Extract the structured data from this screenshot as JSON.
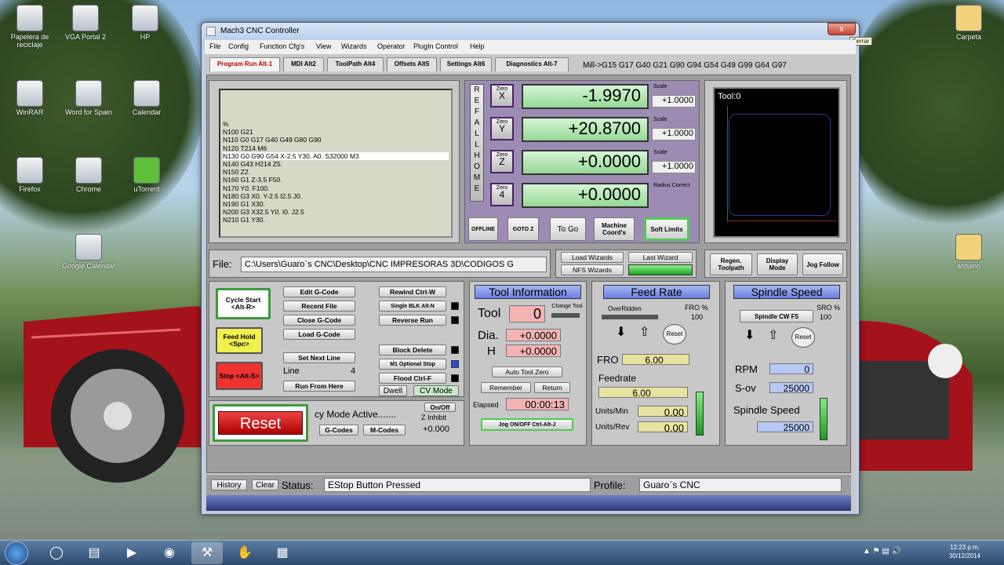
{
  "window": {
    "title": "Mach3 CNC Controller",
    "close_glyph": "x",
    "close_tooltip": "Cerrar"
  },
  "menu": [
    "File",
    "Config",
    "Function Cfg's",
    "View",
    "Wizards",
    "Operator",
    "PlugIn Control",
    "Help"
  ],
  "tabs": [
    "Program Run Alt-1",
    "MDI Alt2",
    "ToolPath Alt4",
    "Offsets Alt5",
    "Settings Alt6",
    "Diagnostics Alt-7"
  ],
  "active_gcodes": "Mill->G15  G17 G40 G21 G90 G94 G54 G49 G99 G64 G97",
  "gcode_lines": [
    "%",
    "N100 G21",
    "N110 G0 G17 G40 G49 G80 G90",
    "N120 T214 M6",
    "N130 G0 G90 G54 X-2.5 Y30. A0. S32000 M3",
    "N140 G43 H214 Z5.",
    "N150 Z2.",
    "N160 G1 Z-3.5 F50.",
    "N170 Y0. F100.",
    "N180 G3 X0. Y-2.5 I2.5 J0.",
    "N190 G1 X30.",
    "N200 G3 X32.5 Y0. I0. J2.5",
    "N210 G1 Y30."
  ],
  "gcode_highlight_index": 4,
  "ref_all_home": [
    "R",
    "E",
    "F",
    "A",
    "L",
    "L",
    "H",
    "O",
    "M",
    "E"
  ],
  "axes": [
    {
      "zero_label": "Zero",
      "axis": "X",
      "value": "-1.9970",
      "scale_label": "Scale",
      "scale": "+1.0000"
    },
    {
      "zero_label": "Zero",
      "axis": "Y",
      "value": "+20.8700",
      "scale_label": "Scale",
      "scale": "+1.0000"
    },
    {
      "zero_label": "Zero",
      "axis": "Z",
      "value": "+0.0000",
      "scale_label": "Scale",
      "scale": "+1.0000"
    },
    {
      "zero_label": "Zero",
      "axis": "4",
      "value": "+0.0000",
      "scale_label": "Radius Correct",
      "scale": ""
    }
  ],
  "dro_buttons": [
    "OFFLINE",
    "GOTO Z",
    "To Go",
    "Machine Coord's",
    "Soft Limits"
  ],
  "toolpath": {
    "label": "Tool:0"
  },
  "file": {
    "label": "File:",
    "path": "C:\\Users\\Guaro`s CNC\\Desktop\\CNC IMPRESORAS 3D\\CODIGOS G"
  },
  "wizards": {
    "load": "Load Wizards",
    "last": "Last Wizard",
    "nfs": "NFS Wizards"
  },
  "view_buttons": [
    "Regen. Toolpath",
    "Display Mode",
    "Jog Follow"
  ],
  "program_buttons": {
    "cycle_start": "Cycle Start <Alt-R>",
    "feed_hold": "Feed Hold <Spc>",
    "stop": "Stop <Alt-S>",
    "edit": "Edit G-Code",
    "recent": "Recent File",
    "close": "Close G-Code",
    "load": "Load G-Code",
    "set_next": "Set Next Line",
    "line_label": "Line",
    "line_value": "4",
    "run_from_here": "Run From Here",
    "rewind": "Rewind Ctrl-W",
    "single_blk": "Single BLK Alt-N",
    "reverse_run": "Reverse Run",
    "block_delete": "Block Delete",
    "m1_optional": "M1 Optional Stop",
    "flood": "Flood Ctrl-F",
    "dwell": "Dwell",
    "cv_mode": "CV Mode"
  },
  "reset": {
    "label": "Reset",
    "cy_mode": "cy Mode Active.......",
    "on_off": "On/Off",
    "z_inhibit": "Z Inhibit",
    "z_value": "+0.000",
    "gcodes_btn": "G-Codes",
    "mcodes_btn": "M-Codes"
  },
  "tool_info": {
    "header": "Tool Information",
    "tool_label": "Tool",
    "tool_value": "0",
    "change": "Change Tool",
    "dia_label": "Dia.",
    "dia_value": "+0.0000",
    "h_label": "H",
    "h_value": "+0.0000",
    "auto_zero": "Auto Tool Zero",
    "remember": "Remember",
    "return": "Return",
    "elapsed_label": "Elapsed",
    "elapsed_value": "00:00:13",
    "jog": "Jog ON/OFF Ctrl-Alt-J"
  },
  "feed": {
    "header": "Feed Rate",
    "overridden": "OverRidden",
    "fro_pct_label": "FRO %",
    "fro_pct": "100",
    "reset": "Reset",
    "fro_label": "FRO",
    "fro_value": "6.00",
    "feedrate_label": "Feedrate",
    "feedrate_value": "6.00",
    "units_min_label": "Units/Min",
    "units_min": "0.00",
    "units_rev_label": "Units/Rev",
    "units_rev": "0.00"
  },
  "spindle": {
    "header": "Spindle Speed",
    "cw": "Spindle CW F5",
    "sro_label": "SRO %",
    "sro": "100",
    "reset": "Reset",
    "rpm_label": "RPM",
    "rpm": "0",
    "sov_label": "S-ov",
    "sov": "25000",
    "speed_label": "Spindle Speed",
    "speed": "25000"
  },
  "status": {
    "history": "History",
    "clear": "Clear",
    "label": "Status:",
    "text": "EStop Button Pressed",
    "profile_label": "Profile:",
    "profile": "Guaro`s CNC"
  },
  "desktop_icons": [
    {
      "label": "Papelera de reciclaje"
    },
    {
      "label": "VGA Portal 2"
    },
    {
      "label": "HP"
    },
    {
      "label": "WinRAR"
    },
    {
      "label": "Word for Spain"
    },
    {
      "label": "Calendar"
    },
    {
      "label": "Firefox"
    },
    {
      "label": "Chrome"
    },
    {
      "label": "uTorrent"
    },
    {
      "label": "Carpeta"
    },
    {
      "label": "Google Calendar"
    },
    {
      "label": "arduino"
    }
  ],
  "taskbar": {
    "clock_time": "12:23 p.m.",
    "clock_date": "30/12/2014"
  }
}
